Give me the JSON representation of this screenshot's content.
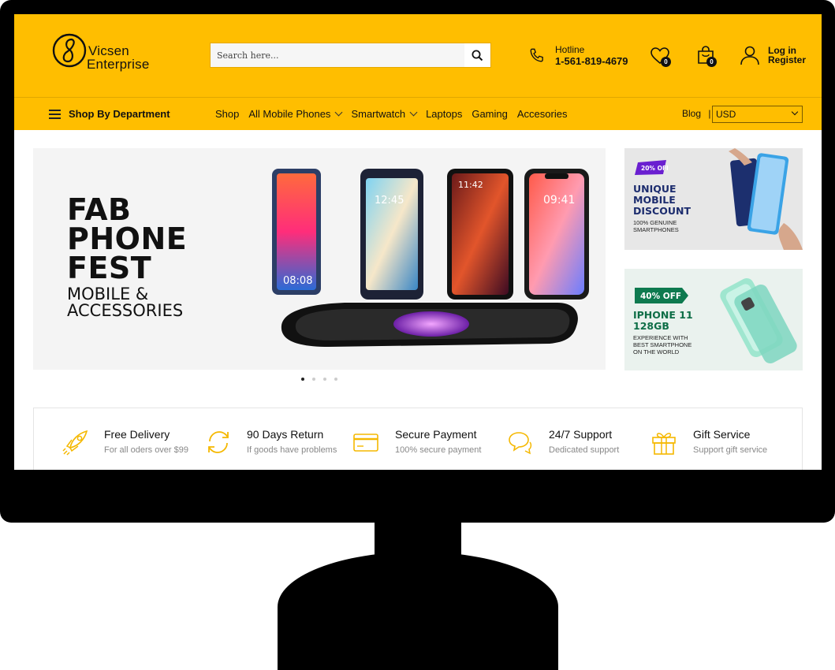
{
  "brand": {
    "line1": "Vicsen",
    "line2": "Enterprise"
  },
  "search": {
    "placeholder": "Search here...",
    "button_icon": "search-icon"
  },
  "hotline": {
    "label": "Hotline",
    "number": "1-561-819-4679"
  },
  "wishlist": {
    "count": "0"
  },
  "cart": {
    "count": "0"
  },
  "account": {
    "login": "Log in",
    "register": "Register"
  },
  "nav": {
    "department": "Shop By Department",
    "items": [
      {
        "label": "Shop",
        "dropdown": false
      },
      {
        "label": "All Mobile Phones",
        "dropdown": true
      },
      {
        "label": "Smartwatch",
        "dropdown": true
      },
      {
        "label": "Laptops",
        "dropdown": false
      },
      {
        "label": "Gaming",
        "dropdown": false
      },
      {
        "label": "Accesories",
        "dropdown": false
      }
    ],
    "blog": "Blog",
    "separator": "|",
    "currency": "USD"
  },
  "hero": {
    "line1": "FAB",
    "line2": "PHONE",
    "line3": "FEST",
    "sub1": "MOBILE &",
    "sub2": "ACCESSORIES",
    "phone_times": [
      "12:45",
      "11:42",
      "09:41",
      "08:08"
    ],
    "slides": 4,
    "active_slide": 1
  },
  "promo1": {
    "badge": "20% OFF",
    "title1": "UNIQUE",
    "title2": "MOBILE",
    "title3": "DISCOUNT",
    "desc1": "100% GENUINE",
    "desc2": "SMARTPHONES"
  },
  "promo2": {
    "badge": "40% OFF",
    "title1": "IPHONE 11",
    "title2": "128GB",
    "desc1": "EXPERIENCE WITH",
    "desc2": "BEST SMARTPHONE",
    "desc3": "ON THE WORLD"
  },
  "services": [
    {
      "title": "Free Delivery",
      "desc": "For all oders over $99",
      "icon": "rocket-icon"
    },
    {
      "title": "90 Days Return",
      "desc": "If goods have problems",
      "icon": "refresh-icon"
    },
    {
      "title": "Secure Payment",
      "desc": "100% secure payment",
      "icon": "credit-card-icon"
    },
    {
      "title": "24/7 Support",
      "desc": "Dedicated support",
      "icon": "chat-icon"
    },
    {
      "title": "Gift Service",
      "desc": "Support gift service",
      "icon": "gift-icon"
    }
  ],
  "colors": {
    "accent": "#ffbe00",
    "icon_accent": "#f5b800",
    "frame": "#000000"
  }
}
